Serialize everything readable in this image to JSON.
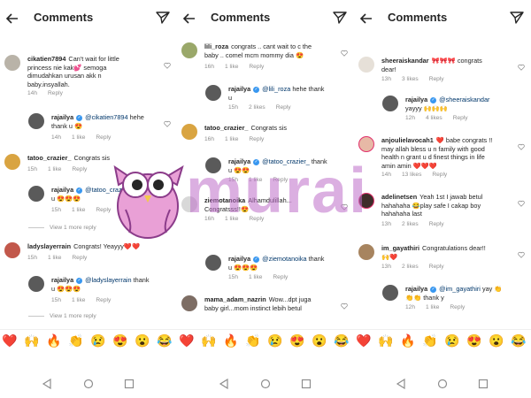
{
  "colors": {
    "accent": "#3897f0",
    "muted": "#8e8e8e",
    "mention": "#00376b",
    "watermark": "#c882d2"
  },
  "watermark": "murai",
  "panels": [
    {
      "title": "Comments",
      "comments": [
        {
          "user": "cikatien7894",
          "verified": false,
          "text": "Can't wait for little princess nie kak💕 semoga dimudahkan urusan akk n baby.insyallah.",
          "time": "14h",
          "likes": "",
          "reply": "Reply"
        },
        {
          "user": "rajailya",
          "verified": true,
          "mention": "@cikatien7894",
          "text": "hehe thank u 😍",
          "time": "14h",
          "likes": "1 like",
          "reply": "Reply"
        },
        {
          "user": "tatoo_crazier_",
          "verified": false,
          "text": "Congrats sis",
          "time": "15h",
          "likes": "1 like",
          "reply": "Reply"
        },
        {
          "user": "rajailya",
          "verified": true,
          "mention": "@tatoo_crazier_",
          "text": "thank u 😍😍😍",
          "time": "15h",
          "likes": "1 like",
          "reply": "Reply"
        },
        {
          "user": "ladyslayerrain",
          "verified": false,
          "text": "Congrats! Yeayyy❤️❤️",
          "time": "15h",
          "likes": "1 like",
          "reply": "Reply"
        },
        {
          "user": "rajailya",
          "verified": true,
          "mention": "@ladyslayerrain",
          "text": "thank u 😍😍😍",
          "time": "15h",
          "likes": "1 like",
          "reply": "Reply"
        }
      ],
      "view_more": [
        "View 1 more reply",
        "View 1 more reply"
      ]
    },
    {
      "title": "Comments",
      "comments": [
        {
          "user": "lili_roza",
          "verified": false,
          "text": "congrats .. cant wait to c the baby .. comel mcm mommy dia 😍",
          "time": "16h",
          "likes": "1 like",
          "reply": "Reply"
        },
        {
          "user": "rajailya",
          "verified": true,
          "mention": "@lili_roza",
          "text": "hehe thank u",
          "time": "15h",
          "likes": "2 likes",
          "reply": "Reply"
        },
        {
          "user": "tatoo_crazier_",
          "verified": false,
          "text": "Congrats sis",
          "time": "16h",
          "likes": "1 like",
          "reply": "Reply"
        },
        {
          "user": "rajailya",
          "verified": true,
          "mention": "@tatoo_crazier_",
          "text": "thank u 😍😍",
          "time": "15h",
          "likes": "1 like",
          "reply": "Reply"
        },
        {
          "user": "ziemotanoika",
          "verified": false,
          "text": "Alhamdulillah... Congratsss!!😍",
          "time": "16h",
          "likes": "1 like",
          "reply": "Reply"
        },
        {
          "user": "rajailya",
          "verified": true,
          "mention": "@ziemotanoika",
          "text": "thank u 😍😍😍",
          "time": "15h",
          "likes": "1 like",
          "reply": "Reply"
        },
        {
          "user": "mama_adam_nazrin",
          "verified": false,
          "text": "Wow...dpt juga baby girl...mom instinct lebih betul",
          "time": "",
          "likes": "",
          "reply": ""
        }
      ],
      "view_more": []
    },
    {
      "title": "Comments",
      "comments": [
        {
          "user": "sheeraiskandar",
          "verified": false,
          "text": "🎀🎀🎀 congrats dear!",
          "time": "13h",
          "likes": "3 likes",
          "reply": "Reply"
        },
        {
          "user": "rajailya",
          "verified": true,
          "mention": "@sheeraiskandar",
          "text": "yayyy 🙌🙌🙌",
          "time": "12h",
          "likes": "4 likes",
          "reply": "Reply"
        },
        {
          "user": "anjoulielavocah1",
          "verified": false,
          "text": "❤️ babe congrats !! may allah bless u n family with good health n grant u d finest things in life amin amin ❤️❤️❤️",
          "time": "14h",
          "likes": "13 likes",
          "reply": "Reply"
        },
        {
          "user": "adelinetsen",
          "verified": false,
          "text": "Yeah 1st I jawab betul hahahaha 😂play safe I cakap boy hahahaha last",
          "time": "13h",
          "likes": "2 likes",
          "reply": "Reply"
        },
        {
          "user": "im_gayathiri",
          "verified": false,
          "text": "Congratulations dear!! 🙌❤️",
          "time": "13h",
          "likes": "2 likes",
          "reply": "Reply"
        },
        {
          "user": "rajailya",
          "verified": true,
          "mention": "@im_gayathiri",
          "text": "yay 👏👏👏 thank y",
          "time": "12h",
          "likes": "1 like",
          "reply": "Reply"
        }
      ],
      "view_more": []
    }
  ],
  "emoji_row": [
    "❤️",
    "🙌",
    "🔥",
    "👏",
    "😢",
    "😍",
    "😮",
    "😂",
    "❤️",
    "🙌",
    "🔥",
    "👏",
    "😢",
    "😍",
    "😮",
    "😂",
    "❤️",
    "🙌",
    "🔥",
    "👏",
    "😢",
    "😍",
    "😮",
    "😂"
  ]
}
